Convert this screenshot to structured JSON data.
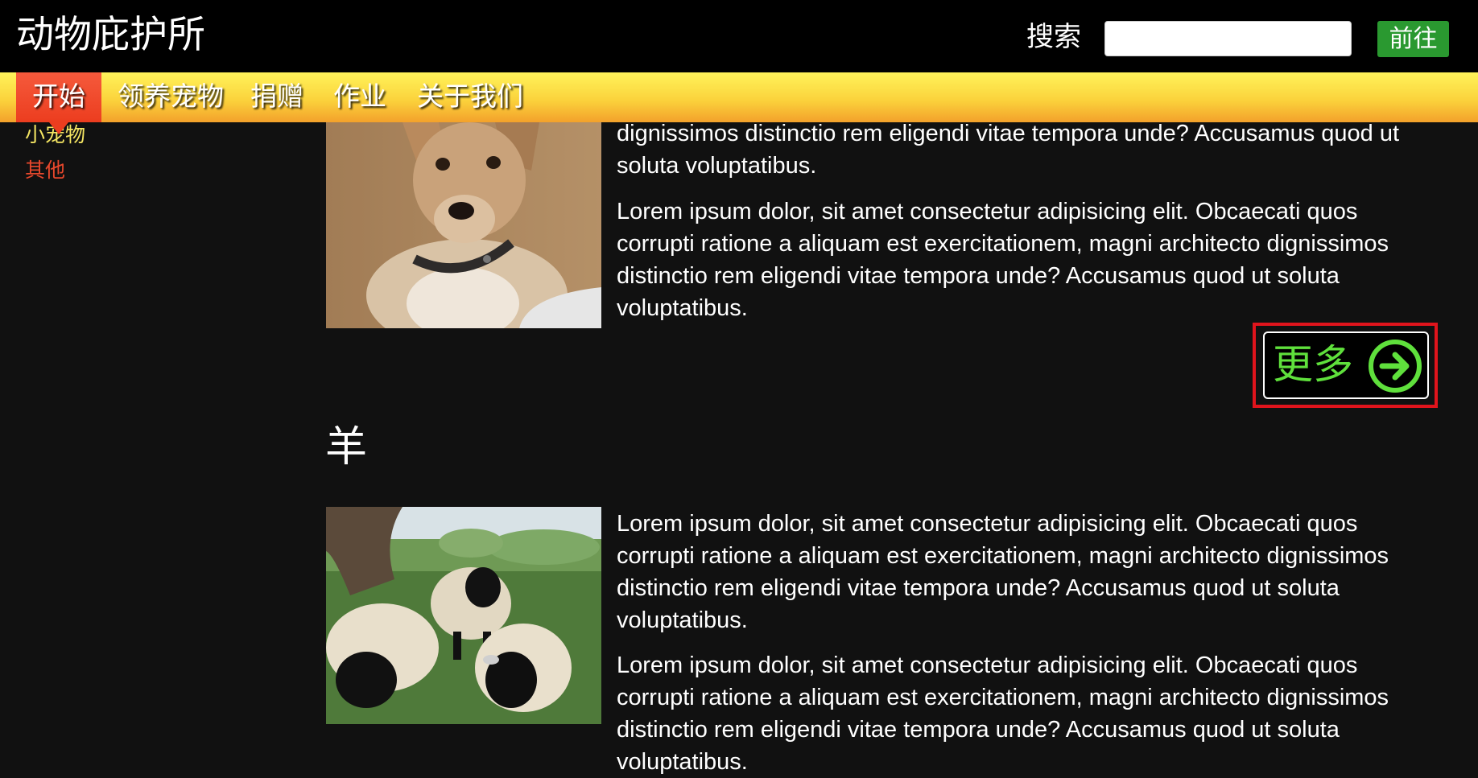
{
  "header": {
    "site_title": "动物庇护所",
    "search_label": "搜索",
    "search_value": "",
    "search_placeholder": "",
    "go_label": "前往"
  },
  "nav": {
    "items": [
      {
        "label": "开始",
        "active": true
      },
      {
        "label": "领养宠物",
        "active": false
      },
      {
        "label": "捐赠",
        "active": false
      },
      {
        "label": "作业",
        "active": false
      },
      {
        "label": "关于我们",
        "active": false
      }
    ]
  },
  "sidebar": {
    "items": [
      {
        "label": "小宠物",
        "color": "#f5e663"
      },
      {
        "label": "其他",
        "color": "#e8482c"
      }
    ]
  },
  "sections": [
    {
      "image_subject": "dog",
      "paragraphs": [
        "dignissimos distinctio rem eligendi vitae tempora unde? Accusamus quod ut soluta voluptatibus.",
        "Lorem ipsum dolor, sit amet consectetur adipisicing elit. Obcaecati quos corrupti ratione a aliquam est exercitationem, magni architecto dignissimos distinctio rem eligendi vitae tempora unde? Accusamus quod ut soluta voluptatibus."
      ],
      "more_label": "更多"
    },
    {
      "heading": "羊",
      "image_subject": "sheep",
      "paragraphs": [
        "Lorem ipsum dolor, sit amet consectetur adipisicing elit. Obcaecati quos corrupti ratione a aliquam est exercitationem, magni architecto dignissimos distinctio rem eligendi vitae tempora unde? Accusamus quod ut soluta voluptatibus.",
        "Lorem ipsum dolor, sit amet consectetur adipisicing elit. Obcaecati quos corrupti ratione a aliquam est exercitationem, magni architecto dignissimos distinctio rem eligendi vitae tempora unde? Accusamus quod ut soluta voluptatibus."
      ]
    }
  ],
  "colors": {
    "header_bg": "#000000",
    "nav_gradient_top": "#fff35a",
    "nav_gradient_bottom": "#f3a12b",
    "nav_active": "#ec3d1f",
    "go_button": "#2a9930",
    "more_accent": "#5fe03c",
    "highlight_frame": "#e0141c",
    "page_bg": "#111111"
  },
  "icons": {
    "more": "arrow-right-circle-icon"
  }
}
